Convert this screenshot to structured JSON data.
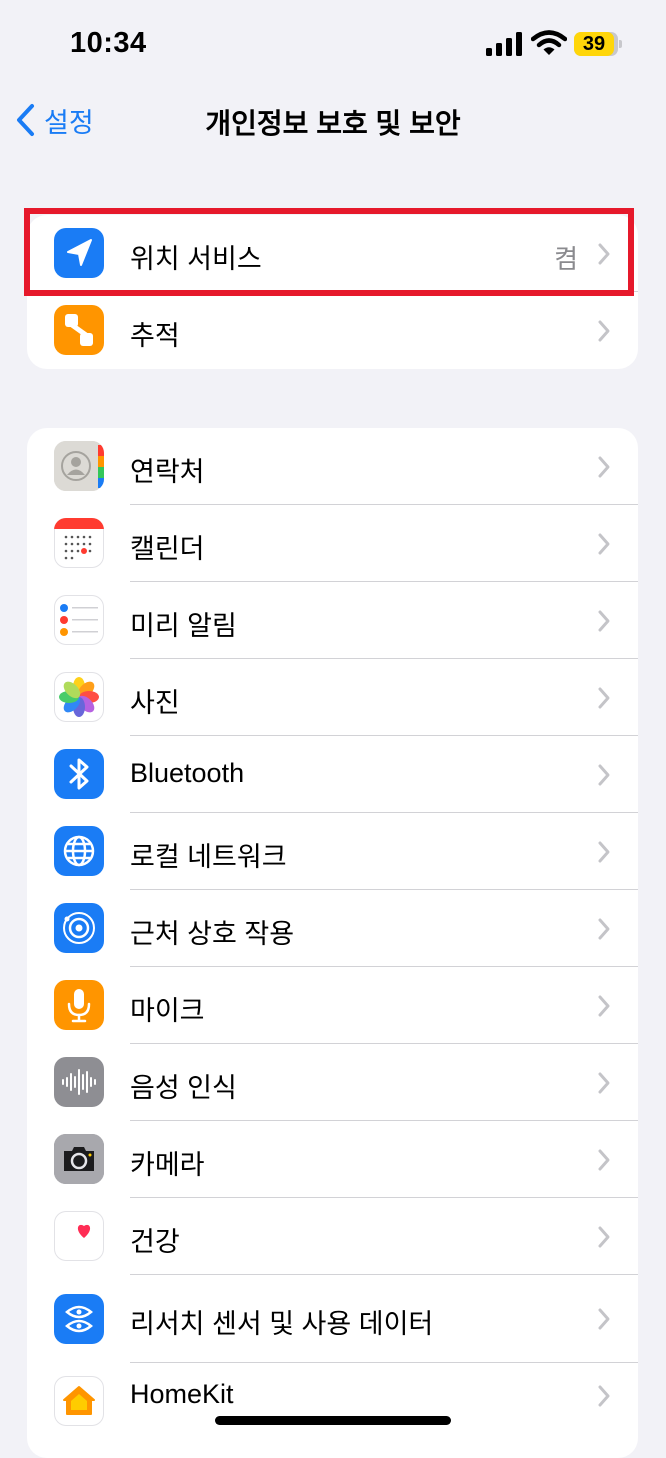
{
  "status_bar": {
    "time": "10:34",
    "battery_level": "39",
    "battery_color": "#ffd60a"
  },
  "nav": {
    "back_label": "설정",
    "title": "개인정보 보호 및 보안",
    "accent_color": "#1a7cf5"
  },
  "group1": {
    "items": [
      {
        "label": "위치 서비스",
        "value": "켬",
        "icon": "location-arrow-icon",
        "icon_color": "#1a7cf5"
      },
      {
        "label": "추적",
        "value": "",
        "icon": "tracking-icon",
        "icon_color": "#ff9500"
      }
    ]
  },
  "group2": {
    "items": [
      {
        "label": "연락처",
        "icon": "contacts-icon"
      },
      {
        "label": "캘린더",
        "icon": "calendar-icon"
      },
      {
        "label": "미리 알림",
        "icon": "reminders-icon"
      },
      {
        "label": "사진",
        "icon": "photos-icon"
      },
      {
        "label": "Bluetooth",
        "icon": "bluetooth-icon",
        "icon_color": "#1a7cf5"
      },
      {
        "label": "로컬 네트워크",
        "icon": "globe-icon",
        "icon_color": "#1a7cf5"
      },
      {
        "label": "근처 상호 작용",
        "icon": "nearby-interaction-icon",
        "icon_color": "#1a7cf5"
      },
      {
        "label": "마이크",
        "icon": "microphone-icon",
        "icon_color": "#ff9500"
      },
      {
        "label": "음성 인식",
        "icon": "speech-recognition-icon",
        "icon_color": "#8e8e93"
      },
      {
        "label": "카메라",
        "icon": "camera-icon",
        "icon_color": "#8e8e93"
      },
      {
        "label": "건강",
        "icon": "health-heart-icon",
        "icon_color": "#ff2d55"
      },
      {
        "label": "리서치 센서 및 사용 데이터",
        "icon": "research-icon",
        "icon_color": "#1a7cf5"
      },
      {
        "label": "HomeKit",
        "icon": "homekit-icon",
        "icon_color": "#ff9500"
      }
    ]
  },
  "highlight_color": "#e6192b"
}
